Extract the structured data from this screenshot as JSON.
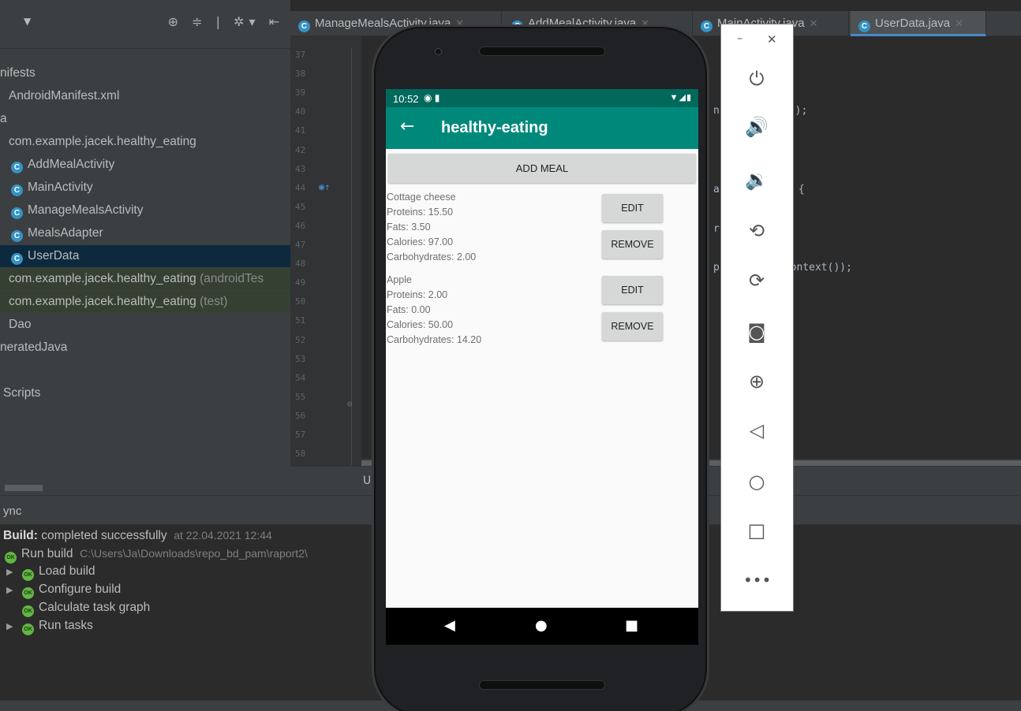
{
  "project": {
    "tree": [
      {
        "label": "nifests",
        "icon": null,
        "suffix": ""
      },
      {
        "label": "AndroidManifest.xml",
        "icon": null,
        "suffix": ""
      },
      {
        "label": "a",
        "icon": null,
        "suffix": ""
      },
      {
        "label": "com.example.jacek.healthy_eating",
        "icon": null,
        "suffix": ""
      },
      {
        "label": "AddMealActivity",
        "icon": "class-icon",
        "suffix": ""
      },
      {
        "label": "MainActivity",
        "icon": "class-icon",
        "suffix": ""
      },
      {
        "label": "ManageMealsActivity",
        "icon": "class-icon",
        "suffix": ""
      },
      {
        "label": "MealsAdapter",
        "icon": "class-icon",
        "suffix": ""
      },
      {
        "label": "UserData",
        "icon": "class-icon",
        "suffix": ""
      },
      {
        "label": "com.example.jacek.healthy_eating",
        "icon": null,
        "suffix": "(androidTes"
      },
      {
        "label": "com.example.jacek.healthy_eating",
        "icon": null,
        "suffix": "(test)"
      },
      {
        "label": "Dao",
        "icon": null,
        "suffix": ""
      },
      {
        "label": "neratedJava",
        "icon": null,
        "suffix": ""
      },
      {
        "label": "Scripts",
        "icon": null,
        "suffix": ""
      }
    ],
    "class_icon_letter": "C"
  },
  "editor": {
    "tabs": [
      {
        "label": "ManageMealsActivity.java"
      },
      {
        "label": "AddMealActivity.java"
      },
      {
        "label": "MainActivity.java"
      },
      {
        "label": "UserData.java"
      }
    ],
    "line_numbers": [
      "37",
      "38",
      "39",
      "40",
      "41",
      "42",
      "43",
      "44",
      "45",
      "46",
      "47",
      "48",
      "49",
      "50",
      "51",
      "52",
      "53",
      "54",
      "55",
      "56",
      "57",
      "58"
    ],
    "code_fragments": {
      "n": "n",
      "n_call": "();",
      "a": "a",
      "a_brace": "{",
      "r": "r",
      "p": "p",
      "p_call": "Context());"
    },
    "status_letter": "U"
  },
  "build": {
    "header": "ync",
    "result_label": "Build:",
    "result_text": "completed successfully",
    "result_time": "at 22.04.2021 12:44",
    "run_label": "Run build",
    "run_path": "C:\\Users\\Ja\\Downloads\\repo_bd_pam\\raport2\\",
    "steps": [
      "Load build",
      "Configure build",
      "Calculate task graph",
      "Run tasks"
    ],
    "ok_badge": "OK"
  },
  "phone": {
    "time": "10:52",
    "app_title": "healthy-eating",
    "add_meal_label": "ADD MEAL",
    "meals": [
      {
        "name": "Cottage cheese",
        "proteins": "Proteins: 15.50",
        "fats": "Fats: 3.50",
        "calories": "Calories: 97.00",
        "carbs": "Carbohydrates: 2.00",
        "edit_label": "EDIT",
        "remove_label": "REMOVE"
      },
      {
        "name": "Apple",
        "proteins": "Proteins: 2.00",
        "fats": "Fats: 0.00",
        "calories": "Calories: 50.00",
        "carbs": "Carbohydrates: 14.20",
        "edit_label": "EDIT",
        "remove_label": "REMOVE"
      }
    ]
  },
  "emulator_toolbar": {
    "items": [
      "power-icon",
      "volume-up-icon",
      "volume-down-icon",
      "rotate-left-icon",
      "rotate-right-icon",
      "screenshot-icon",
      "zoom-icon",
      "back-icon",
      "home-icon",
      "overview-icon",
      "more-icon"
    ]
  },
  "colors": {
    "app_bar": "#00897b",
    "status_bar": "#00695c",
    "ide_panel": "#3c3f41",
    "ide_editor": "#2b2b2b",
    "selection": "#0d293e",
    "class_icon": "#3592c4",
    "ok_green": "#62b543"
  }
}
